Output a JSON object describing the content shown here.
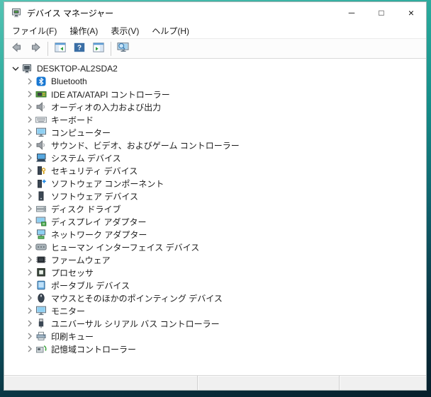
{
  "window": {
    "title": "デバイス マネージャー",
    "app_icon": "device-manager-icon",
    "controls": [
      {
        "name": "minimize-button",
        "icon": "minimize-icon",
        "glyph": "─"
      },
      {
        "name": "maximize-button",
        "icon": "maximize-icon",
        "glyph": "□"
      },
      {
        "name": "close-button",
        "icon": "close-icon",
        "glyph": "×"
      }
    ]
  },
  "menu": {
    "items": [
      {
        "name": "menu-file",
        "label": "ファイル(F)"
      },
      {
        "name": "menu-action",
        "label": "操作(A)"
      },
      {
        "name": "menu-view",
        "label": "表示(V)"
      },
      {
        "name": "menu-help",
        "label": "ヘルプ(H)"
      }
    ]
  },
  "toolbar": {
    "buttons": [
      {
        "name": "back-button",
        "icon": "arrow-left-icon"
      },
      {
        "name": "forward-button",
        "icon": "arrow-right-icon"
      },
      {
        "name": "separator"
      },
      {
        "name": "console-tree-button",
        "icon": "console-tree-icon"
      },
      {
        "name": "help-button",
        "icon": "help-icon"
      },
      {
        "name": "action-pane-button",
        "icon": "action-pane-icon"
      },
      {
        "name": "separator"
      },
      {
        "name": "scan-hardware-button",
        "icon": "scan-hardware-icon"
      }
    ]
  },
  "tree": {
    "root": {
      "label": "DESKTOP-AL2SDA2",
      "icon": "computer-root-icon",
      "expanded": true
    },
    "items": [
      {
        "icon": "bluetooth-icon",
        "label": "Bluetooth"
      },
      {
        "icon": "ide-controller-icon",
        "label": "IDE ATA/ATAPI コントローラー"
      },
      {
        "icon": "audio-io-icon",
        "label": "オーディオの入力および出力"
      },
      {
        "icon": "keyboard-icon",
        "label": "キーボード"
      },
      {
        "icon": "computer-icon",
        "label": "コンピューター"
      },
      {
        "icon": "sound-game-icon",
        "label": "サウンド、ビデオ、およびゲーム コントローラー"
      },
      {
        "icon": "system-devices-icon",
        "label": "システム デバイス"
      },
      {
        "icon": "security-devices-icon",
        "label": "セキュリティ デバイス"
      },
      {
        "icon": "software-component-icon",
        "label": "ソフトウェア コンポーネント"
      },
      {
        "icon": "software-device-icon",
        "label": "ソフトウェア デバイス"
      },
      {
        "icon": "disk-drive-icon",
        "label": "ディスク ドライブ"
      },
      {
        "icon": "display-adapter-icon",
        "label": "ディスプレイ アダプター"
      },
      {
        "icon": "network-adapter-icon",
        "label": "ネットワーク アダプター"
      },
      {
        "icon": "hid-icon",
        "label": "ヒューマン インターフェイス デバイス"
      },
      {
        "icon": "firmware-icon",
        "label": "ファームウェア"
      },
      {
        "icon": "processor-icon",
        "label": "プロセッサ"
      },
      {
        "icon": "portable-device-icon",
        "label": "ポータブル デバイス"
      },
      {
        "icon": "mouse-icon",
        "label": "マウスとそのほかのポインティング デバイス"
      },
      {
        "icon": "monitor-icon",
        "label": "モニター"
      },
      {
        "icon": "usb-controller-icon",
        "label": "ユニバーサル シリアル バス コントローラー"
      },
      {
        "icon": "print-queue-icon",
        "label": "印刷キュー"
      },
      {
        "icon": "storage-controller-icon",
        "label": "記憶域コントローラー"
      }
    ]
  },
  "statusbar": {
    "cells": [
      "",
      "",
      ""
    ]
  },
  "colors": {
    "desktop_top": "#55c4b4",
    "desktop_bottom": "#071f2b",
    "help_blue": "#3a6ea5",
    "bluetooth_blue": "#1877d2",
    "board_green": "#55a042"
  }
}
